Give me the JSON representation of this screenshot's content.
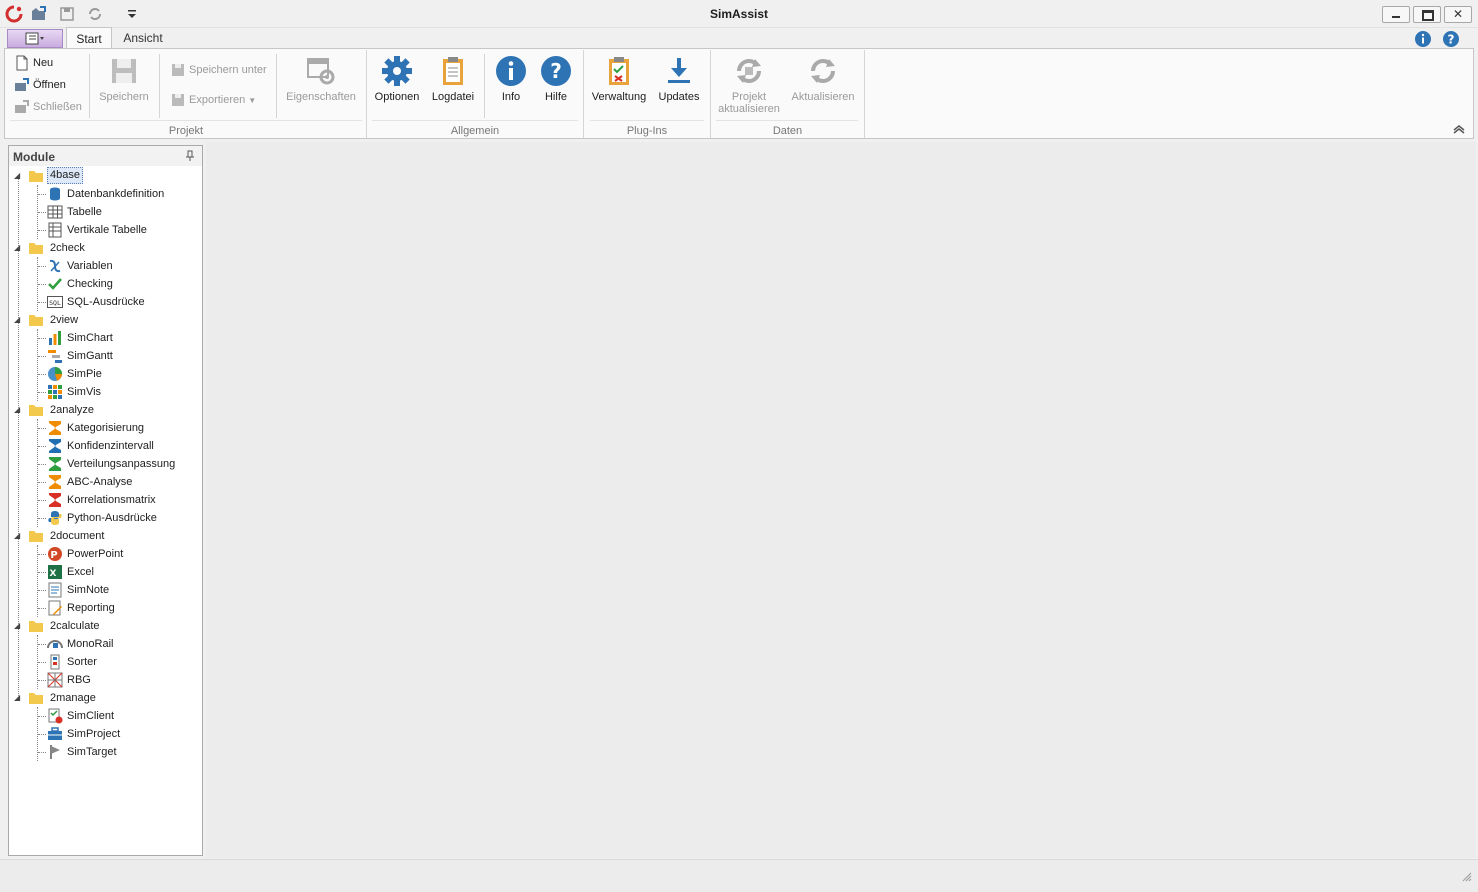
{
  "app": {
    "title": "SimAssist",
    "tabs": [
      {
        "label": "Start"
      },
      {
        "label": "Ansicht"
      }
    ]
  },
  "ribbon": {
    "groups": {
      "projekt": {
        "label": "Projekt",
        "neu": "Neu",
        "oeffnen": "Öffnen",
        "schliessen": "Schließen",
        "speichern": "Speichern",
        "speichern_unter": "Speichern unter",
        "exportieren": "Exportieren",
        "eigenschaften": "Eigenschaften"
      },
      "allgemein": {
        "label": "Allgemein",
        "optionen": "Optionen",
        "logdatei": "Logdatei",
        "info": "Info",
        "hilfe": "Hilfe"
      },
      "plugins": {
        "label": "Plug-Ins",
        "verwaltung": "Verwaltung",
        "updates": "Updates"
      },
      "daten": {
        "label": "Daten",
        "projekt_line1": "Projekt",
        "projekt_line2": "aktualisieren",
        "aktualisieren": "Aktualisieren"
      }
    }
  },
  "modules": {
    "title": "Module",
    "groups": [
      {
        "label": "4base",
        "items": [
          "Datenbankdefinition",
          "Tabelle",
          "Vertikale Tabelle"
        ]
      },
      {
        "label": "2check",
        "items": [
          "Variablen",
          "Checking",
          "SQL-Ausdrücke"
        ]
      },
      {
        "label": "2view",
        "items": [
          "SimChart",
          "SimGantt",
          "SimPie",
          "SimVis"
        ]
      },
      {
        "label": "2analyze",
        "items": [
          "Kategorisierung",
          "Konfidenzintervall",
          "Verteilungsanpassung",
          "ABC-Analyse",
          "Korrelationsmatrix",
          "Python-Ausdrücke"
        ]
      },
      {
        "label": "2document",
        "items": [
          "PowerPoint",
          "Excel",
          "SimNote",
          "Reporting"
        ]
      },
      {
        "label": "2calculate",
        "items": [
          "MonoRail",
          "Sorter",
          "RBG"
        ]
      },
      {
        "label": "2manage",
        "items": [
          "SimClient",
          "SimProject",
          "SimTarget"
        ]
      }
    ]
  },
  "colors": {
    "accent_blue": "#2e74b5",
    "folder": "#f2c94c",
    "sigma_orange": "#f08c00",
    "sigma_blue": "#1f6fb2",
    "sigma_green": "#2e9e3e",
    "sigma_red": "#d93025"
  }
}
